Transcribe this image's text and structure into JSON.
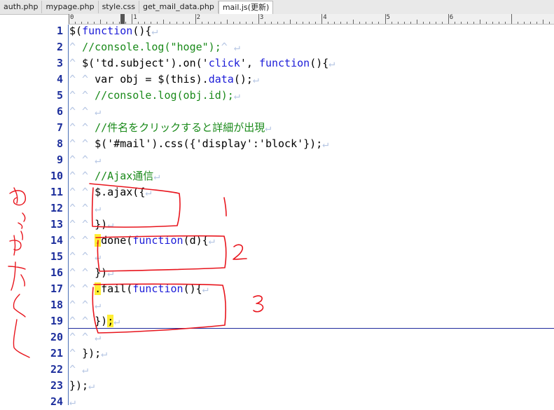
{
  "tabs": [
    {
      "label": "auth.php",
      "active": false
    },
    {
      "label": "mypage.php",
      "active": false
    },
    {
      "label": "style.css",
      "active": false
    },
    {
      "label": "get_mail_data.php",
      "active": false
    },
    {
      "label": "mail.js(更新)",
      "active": true
    }
  ],
  "ruler": {
    "labels": [
      "0",
      "1",
      "2",
      "3",
      "4",
      "5",
      "6"
    ]
  },
  "editor": {
    "lines": [
      {
        "n": "1",
        "tokens": [
          {
            "t": "$(",
            "c": ""
          },
          {
            "t": "function",
            "c": "kw"
          },
          {
            "t": "(){",
            "c": ""
          },
          {
            "t": "↵",
            "c": "nl"
          }
        ]
      },
      {
        "n": "2",
        "tokens": [
          {
            "t": "^ ",
            "c": "ind"
          },
          {
            "t": "//console.log(\"hoge\");",
            "c": "cm"
          },
          {
            "t": "^ ",
            "c": "ind"
          },
          {
            "t": "↵",
            "c": "nl"
          }
        ]
      },
      {
        "n": "3",
        "tokens": [
          {
            "t": "^ ",
            "c": "ind"
          },
          {
            "t": "$('td.subject').on('",
            "c": ""
          },
          {
            "t": "click",
            "c": "kw"
          },
          {
            "t": "', ",
            "c": ""
          },
          {
            "t": "function",
            "c": "kw"
          },
          {
            "t": "(){",
            "c": ""
          },
          {
            "t": "↵",
            "c": "nl"
          }
        ]
      },
      {
        "n": "4",
        "tokens": [
          {
            "t": "^ ^ ",
            "c": "ind"
          },
          {
            "t": "var obj = $(this).",
            "c": ""
          },
          {
            "t": "data",
            "c": "kw"
          },
          {
            "t": "();",
            "c": ""
          },
          {
            "t": "↵",
            "c": "nl"
          }
        ]
      },
      {
        "n": "5",
        "tokens": [
          {
            "t": "^ ^ ",
            "c": "ind"
          },
          {
            "t": "//console.log(obj.id);",
            "c": "cm"
          },
          {
            "t": "↵",
            "c": "nl"
          }
        ]
      },
      {
        "n": "6",
        "tokens": [
          {
            "t": "^ ^ ",
            "c": "ind"
          },
          {
            "t": "↵",
            "c": "nl"
          }
        ]
      },
      {
        "n": "7",
        "tokens": [
          {
            "t": "^ ^ ",
            "c": "ind"
          },
          {
            "t": "//件名をクリックすると詳細が出現",
            "c": "cm"
          },
          {
            "t": "↵",
            "c": "nl"
          }
        ]
      },
      {
        "n": "8",
        "tokens": [
          {
            "t": "^ ^ ",
            "c": "ind"
          },
          {
            "t": "$('#mail').css({'display':'block'});",
            "c": ""
          },
          {
            "t": "↵",
            "c": "nl"
          }
        ]
      },
      {
        "n": "9",
        "tokens": [
          {
            "t": "^ ^ ",
            "c": "ind"
          },
          {
            "t": "↵",
            "c": "nl"
          }
        ]
      },
      {
        "n": "10",
        "tokens": [
          {
            "t": "^ ^ ",
            "c": "ind"
          },
          {
            "t": "//Ajax通信",
            "c": "cm"
          },
          {
            "t": "↵",
            "c": "nl"
          }
        ]
      },
      {
        "n": "11",
        "tokens": [
          {
            "t": "^ ^ ",
            "c": "ind"
          },
          {
            "t": "$.ajax({",
            "c": ""
          },
          {
            "t": "↵",
            "c": "nl"
          }
        ]
      },
      {
        "n": "12",
        "tokens": [
          {
            "t": "^ ^ ",
            "c": "ind"
          },
          {
            "t": "↵",
            "c": "nl"
          }
        ]
      },
      {
        "n": "13",
        "tokens": [
          {
            "t": "^ ^ ",
            "c": "ind"
          },
          {
            "t": "})",
            "c": ""
          },
          {
            "t": "↵",
            "c": "nl"
          }
        ]
      },
      {
        "n": "14",
        "tokens": [
          {
            "t": "^ ^ ",
            "c": "ind"
          },
          {
            "t": ".",
            "c": "hl"
          },
          {
            "t": "done(",
            "c": ""
          },
          {
            "t": "function",
            "c": "kw"
          },
          {
            "t": "(d){",
            "c": ""
          },
          {
            "t": "↵",
            "c": "nl"
          }
        ]
      },
      {
        "n": "15",
        "tokens": [
          {
            "t": "^ ^ ",
            "c": "ind"
          },
          {
            "t": "↵",
            "c": "nl"
          }
        ]
      },
      {
        "n": "16",
        "tokens": [
          {
            "t": "^ ^ ",
            "c": "ind"
          },
          {
            "t": "})",
            "c": ""
          },
          {
            "t": "↵",
            "c": "nl"
          }
        ]
      },
      {
        "n": "17",
        "tokens": [
          {
            "t": "^ ^ ",
            "c": "ind"
          },
          {
            "t": ".",
            "c": "hl"
          },
          {
            "t": "fail(",
            "c": ""
          },
          {
            "t": "function",
            "c": "kw"
          },
          {
            "t": "(){",
            "c": ""
          },
          {
            "t": "↵",
            "c": "nl"
          }
        ]
      },
      {
        "n": "18",
        "tokens": [
          {
            "t": "^ ^ ",
            "c": "ind"
          },
          {
            "t": "↵",
            "c": "nl"
          }
        ]
      },
      {
        "n": "19",
        "tokens": [
          {
            "t": "^ ^ ",
            "c": "ind"
          },
          {
            "t": "})",
            "c": ""
          },
          {
            "t": ";",
            "c": "hl"
          },
          {
            "t": "↵",
            "c": "nl"
          }
        ]
      },
      {
        "n": "20",
        "tokens": [
          {
            "t": "^ ^ ",
            "c": "ind"
          },
          {
            "t": "↵",
            "c": "nl"
          }
        ]
      },
      {
        "n": "21",
        "tokens": [
          {
            "t": "^ ",
            "c": "ind"
          },
          {
            "t": "});",
            "c": ""
          },
          {
            "t": "↵",
            "c": "nl"
          }
        ]
      },
      {
        "n": "22",
        "tokens": [
          {
            "t": "^ ",
            "c": "ind"
          },
          {
            "t": "↵",
            "c": "nl"
          }
        ]
      },
      {
        "n": "23",
        "tokens": [
          {
            "t": "});",
            "c": ""
          },
          {
            "t": "↵",
            "c": "nl"
          }
        ]
      },
      {
        "n": "24",
        "tokens": [
          {
            "t": "↵",
            "c": "nl"
          }
        ]
      }
    ]
  },
  "annotations": {
    "box_labels": [
      "1",
      "2",
      "3"
    ],
    "side_note": "めっちゃかく",
    "ink_color": "#e8151d",
    "highlight_color": "#ffee33",
    "keyword_color": "#1b1bd8",
    "comment_color": "#1a8a1a",
    "line_number_color": "#1c2e9c"
  }
}
